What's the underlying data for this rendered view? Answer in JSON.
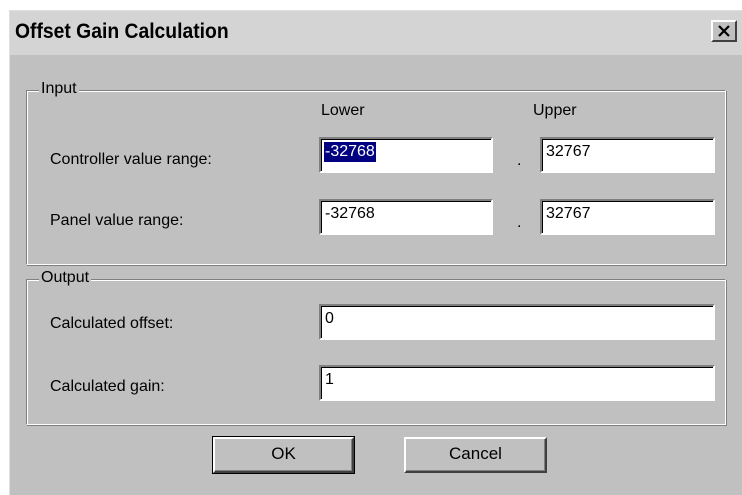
{
  "window": {
    "title": "Offset Gain Calculation"
  },
  "icons": {
    "close": "close-icon"
  },
  "input_group": {
    "label": "Input",
    "col_lower": "Lower",
    "col_upper": "Upper",
    "separator": ".",
    "rows": [
      {
        "label": "Controller value range:",
        "lower": "-32768",
        "upper": "32767",
        "lower_selected": true
      },
      {
        "label": "Panel value range:",
        "lower": "-32768",
        "upper": "32767",
        "lower_selected": false
      }
    ]
  },
  "output_group": {
    "label": "Output",
    "offset_label": "Calculated offset:",
    "offset_value": "0",
    "gain_label": "Calculated gain:",
    "gain_value": "1"
  },
  "buttons": {
    "ok": "OK",
    "cancel": "Cancel"
  },
  "colors": {
    "selection": "#000080",
    "face": "#c0c0c0"
  }
}
